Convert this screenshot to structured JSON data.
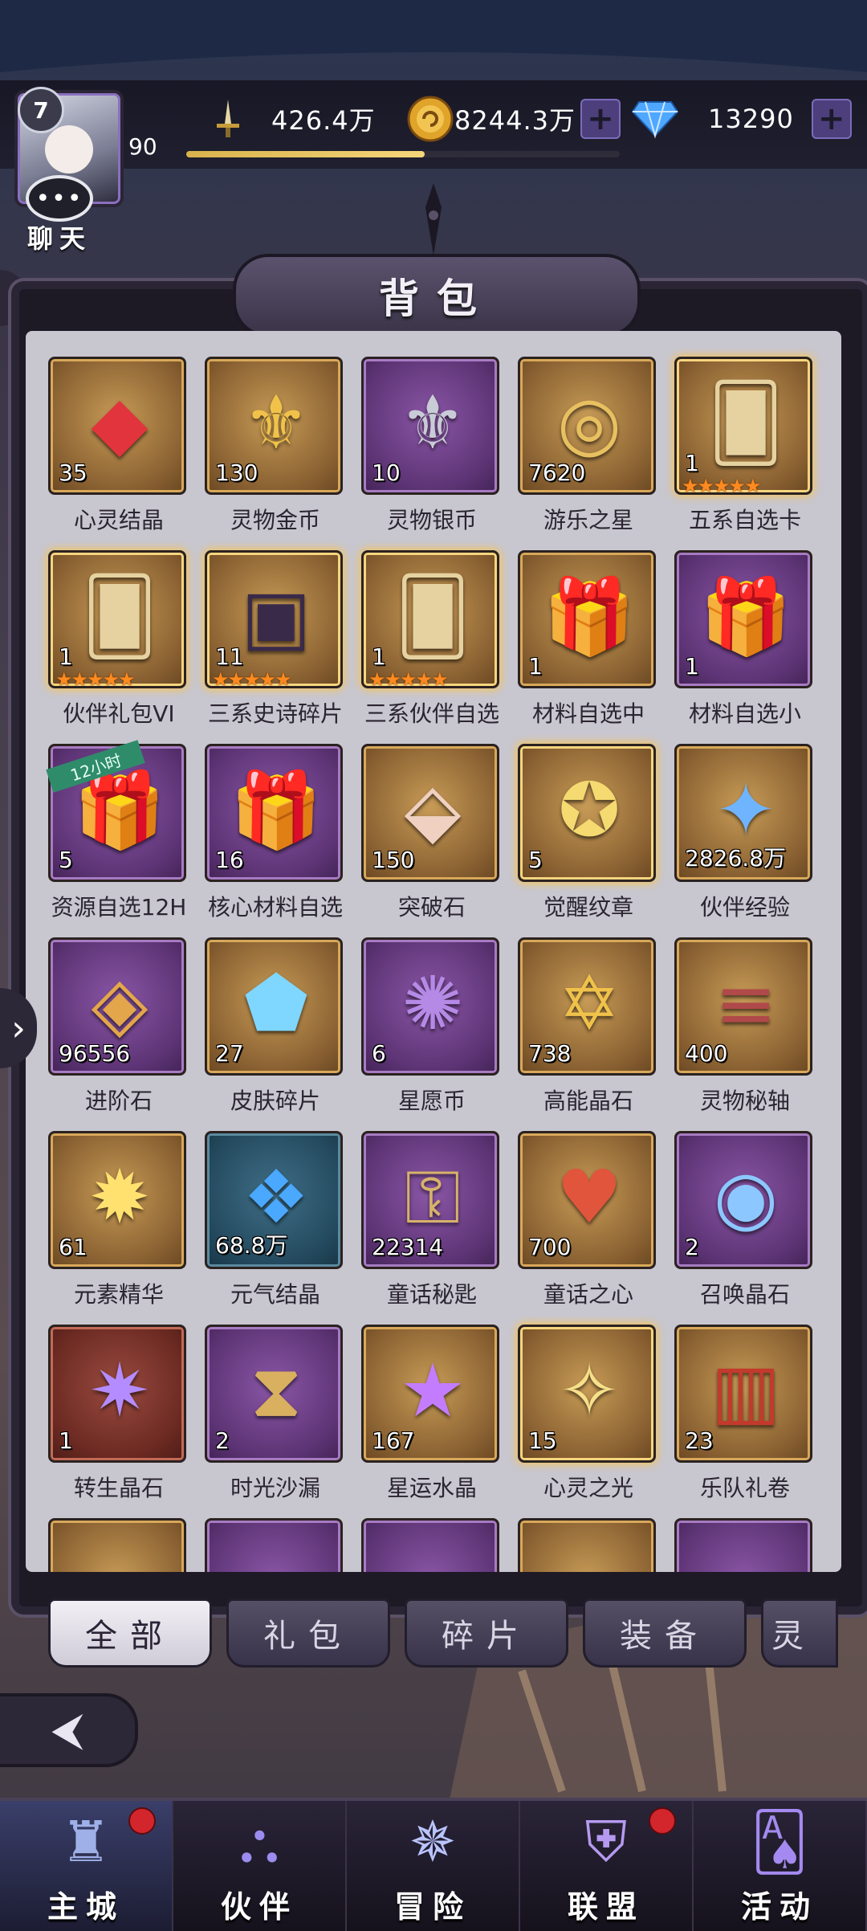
{
  "header": {
    "player_level": "7",
    "xp_current": "90",
    "xp_progress": 0.55,
    "chat_label": "聊天",
    "resources": [
      {
        "icon": "sword-icon",
        "value": "426.4万"
      },
      {
        "icon": "gold-coin-icon",
        "value": "8244.3万"
      },
      {
        "icon": "diamond-icon",
        "value": "13290"
      }
    ]
  },
  "panel": {
    "title": "背包"
  },
  "items": [
    {
      "name": "心灵结晶",
      "count": "35",
      "frame": "gold",
      "icon": "red-crystal-icon",
      "stars": 0
    },
    {
      "name": "灵物金币",
      "count": "130",
      "frame": "gold",
      "icon": "gold-medal-icon",
      "stars": 0
    },
    {
      "name": "灵物银币",
      "count": "10",
      "frame": "purple",
      "icon": "silver-medal-icon",
      "stars": 0
    },
    {
      "name": "游乐之星",
      "count": "7620",
      "frame": "gold",
      "icon": "bell-coin-icon",
      "stars": 0
    },
    {
      "name": "五系自选卡",
      "count": "1",
      "frame": "gold",
      "icon": "card-icon",
      "stars": 5
    },
    {
      "name": "伙伴礼包VI",
      "count": "1",
      "frame": "gold",
      "icon": "card-icon",
      "stars": 5
    },
    {
      "name": "三系史诗碎片",
      "count": "11",
      "frame": "gold",
      "icon": "treasure-chest-icon",
      "stars": 5
    },
    {
      "name": "三系伙伴自选",
      "count": "1",
      "frame": "gold",
      "icon": "card-icon",
      "stars": 5
    },
    {
      "name": "材料自选中",
      "count": "1",
      "frame": "gold",
      "icon": "gift-box-icon",
      "stars": 0
    },
    {
      "name": "材料自选小",
      "count": "1",
      "frame": "purple",
      "icon": "gift-box-icon",
      "stars": 0
    },
    {
      "name": "资源自选12H",
      "count": "5",
      "frame": "purple",
      "icon": "gift-box-icon",
      "stars": 0,
      "ribbon": "12小时"
    },
    {
      "name": "核心材料自选",
      "count": "16",
      "frame": "purple",
      "icon": "gift-box-icon",
      "stars": 0
    },
    {
      "name": "突破石",
      "count": "150",
      "frame": "gold",
      "icon": "crystal-shard-icon",
      "stars": 0
    },
    {
      "name": "觉醒纹章",
      "count": "5",
      "frame": "gold",
      "icon": "emblem-icon",
      "stars": 0
    },
    {
      "name": "伙伴经验",
      "count": "2826.8万",
      "frame": "gold",
      "icon": "exp-star-icon",
      "stars": 0
    },
    {
      "name": "进阶石",
      "count": "96556",
      "frame": "purple",
      "icon": "stone-icon",
      "stars": 0
    },
    {
      "name": "皮肤碎片",
      "count": "27",
      "frame": "gold",
      "icon": "blue-gem-icon",
      "stars": 0
    },
    {
      "name": "星愿币",
      "count": "6",
      "frame": "purple",
      "icon": "star-coin-icon",
      "stars": 0
    },
    {
      "name": "高能晶石",
      "count": "738",
      "frame": "gold",
      "icon": "scroll-gem-icon",
      "stars": 0
    },
    {
      "name": "灵物秘轴",
      "count": "400",
      "frame": "gold",
      "icon": "scroll-icon",
      "stars": 0
    },
    {
      "name": "元素精华",
      "count": "61",
      "frame": "gold",
      "icon": "flame-orb-icon",
      "stars": 0
    },
    {
      "name": "元气结晶",
      "count": "68.8万",
      "frame": "teal",
      "icon": "blue-crystal-icon",
      "stars": 0
    },
    {
      "name": "童话秘匙",
      "count": "22314",
      "frame": "purple",
      "icon": "key-icon",
      "stars": 0
    },
    {
      "name": "童话之心",
      "count": "700",
      "frame": "gold",
      "icon": "heart-gem-icon",
      "stars": 0
    },
    {
      "name": "召唤晶石",
      "count": "2",
      "frame": "purple",
      "icon": "summon-stone-icon",
      "stars": 0
    },
    {
      "name": "转生晶石",
      "count": "1",
      "frame": "red",
      "icon": "purple-orb-icon",
      "stars": 0
    },
    {
      "name": "时光沙漏",
      "count": "2",
      "frame": "purple",
      "icon": "hourglass-icon",
      "stars": 0
    },
    {
      "name": "星运水晶",
      "count": "167",
      "frame": "gold",
      "icon": "purple-star-icon",
      "stars": 0
    },
    {
      "name": "心灵之光",
      "count": "15",
      "frame": "gold",
      "icon": "compass-star-icon",
      "stars": 0
    },
    {
      "name": "乐队礼卷",
      "count": "23",
      "frame": "gold",
      "icon": "red-scroll-icon",
      "stars": 0
    }
  ],
  "tabs": [
    {
      "label": "全部",
      "active": true
    },
    {
      "label": "礼包",
      "active": false
    },
    {
      "label": "碎片",
      "active": false
    },
    {
      "label": "装备",
      "active": false
    },
    {
      "label": "灵",
      "active": false
    }
  ],
  "bottom_nav": [
    {
      "label": "主城",
      "icon": "castle-icon",
      "active": true,
      "badge": true
    },
    {
      "label": "伙伴",
      "icon": "witch-hat-icon",
      "active": false,
      "badge": false
    },
    {
      "label": "冒险",
      "icon": "compass-icon",
      "active": false,
      "badge": false
    },
    {
      "label": "联盟",
      "icon": "shield-icon",
      "active": false,
      "badge": true
    },
    {
      "label": "活动",
      "icon": "cards-icon",
      "active": false,
      "badge": false
    }
  ]
}
